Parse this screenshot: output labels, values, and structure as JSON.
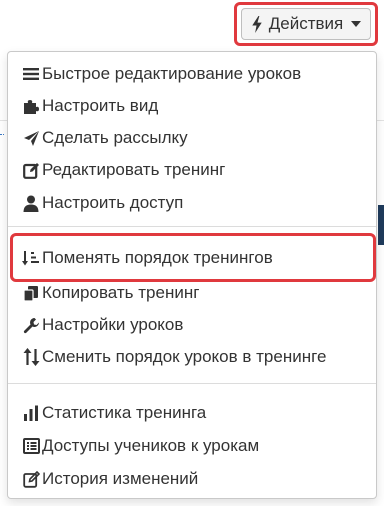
{
  "toolbar": {
    "actions_label": "Действия",
    "actions_icon": "bolt-icon",
    "caret_icon": "caret-down-icon",
    "highlight_color": "#e0393e"
  },
  "menu": {
    "groups": [
      {
        "items": [
          {
            "label": "Быстрое редактирование уроков",
            "icon": "list-icon"
          },
          {
            "label": "Настроить вид",
            "icon": "puzzle-icon"
          },
          {
            "label": "Сделать рассылку",
            "icon": "paper-plane-icon"
          },
          {
            "label": "Редактировать тренинг",
            "icon": "edit-icon"
          },
          {
            "label": "Настроить доступ",
            "icon": "user-icon"
          }
        ]
      },
      {
        "items": [
          {
            "label": "Поменять порядок тренингов",
            "icon": "sort-amount-icon",
            "highlighted": true
          },
          {
            "label": "Копировать тренинг",
            "icon": "copy-icon"
          },
          {
            "label": "Настройки уроков",
            "icon": "wrench-icon"
          },
          {
            "label": "Сменить порядок уроков в тренинге",
            "icon": "sort-arrows-icon"
          }
        ]
      },
      {
        "items": [
          {
            "label": "Статистика тренинга",
            "icon": "bar-chart-icon"
          },
          {
            "label": "Доступы учеников к урокам",
            "icon": "list-alt-icon"
          },
          {
            "label": "История изменений",
            "icon": "history-edit-icon"
          }
        ]
      }
    ]
  }
}
